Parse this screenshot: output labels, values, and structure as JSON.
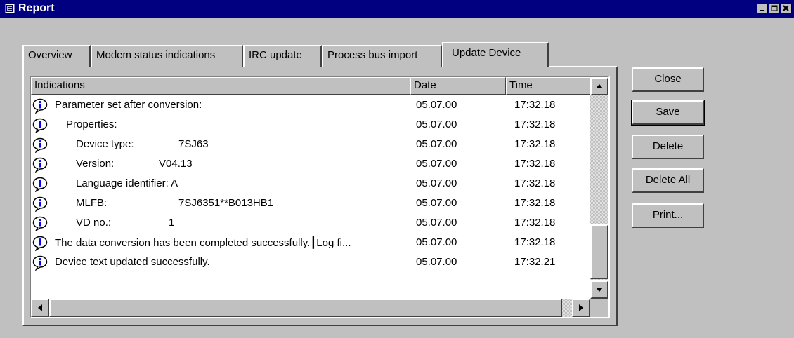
{
  "window": {
    "title": "Report"
  },
  "tabs": [
    {
      "label": "Overview"
    },
    {
      "label": "Modem status indications"
    },
    {
      "label": "IRC update"
    },
    {
      "label": "Process bus import"
    },
    {
      "label": "Update Device",
      "active": true
    }
  ],
  "list": {
    "columns": {
      "indications": "Indications",
      "date": "Date",
      "time": "Time"
    },
    "rows": [
      {
        "text": "Parameter set after conversion:",
        "value": "",
        "date": "05.07.00",
        "time": "17:32.18"
      },
      {
        "text": "Properties:",
        "value": "",
        "date": "05.07.00",
        "time": "17:32.18"
      },
      {
        "text": "Device type:",
        "value": "7SJ63",
        "date": "05.07.00",
        "time": "17:32.18"
      },
      {
        "text": "Version:",
        "value": "V04.13",
        "date": "05.07.00",
        "time": "17:32.18"
      },
      {
        "text": "Language identifier: A",
        "value": "",
        "date": "05.07.00",
        "time": "17:32.18"
      },
      {
        "text": "MLFB:",
        "value": "7SJ6351**B013HB1",
        "date": "05.07.00",
        "time": "17:32.18"
      },
      {
        "text": "VD no.:",
        "value": "1",
        "date": "05.07.00",
        "time": "17:32.18"
      },
      {
        "text": "The data conversion has been completed successfully.┃Log fi...",
        "value": "",
        "date": "05.07.00",
        "time": "17:32.18"
      },
      {
        "text": "Device text updated successfully.",
        "value": "",
        "date": "05.07.00",
        "time": "17:32.21"
      }
    ]
  },
  "buttons": {
    "close": "Close",
    "save": "Save",
    "delete": "Delete",
    "delete_all": "Delete All",
    "print": "Print..."
  },
  "icons": {
    "row_icon": "info-balloon-icon",
    "accent": "#0000ff",
    "titlebar": "#000080"
  }
}
